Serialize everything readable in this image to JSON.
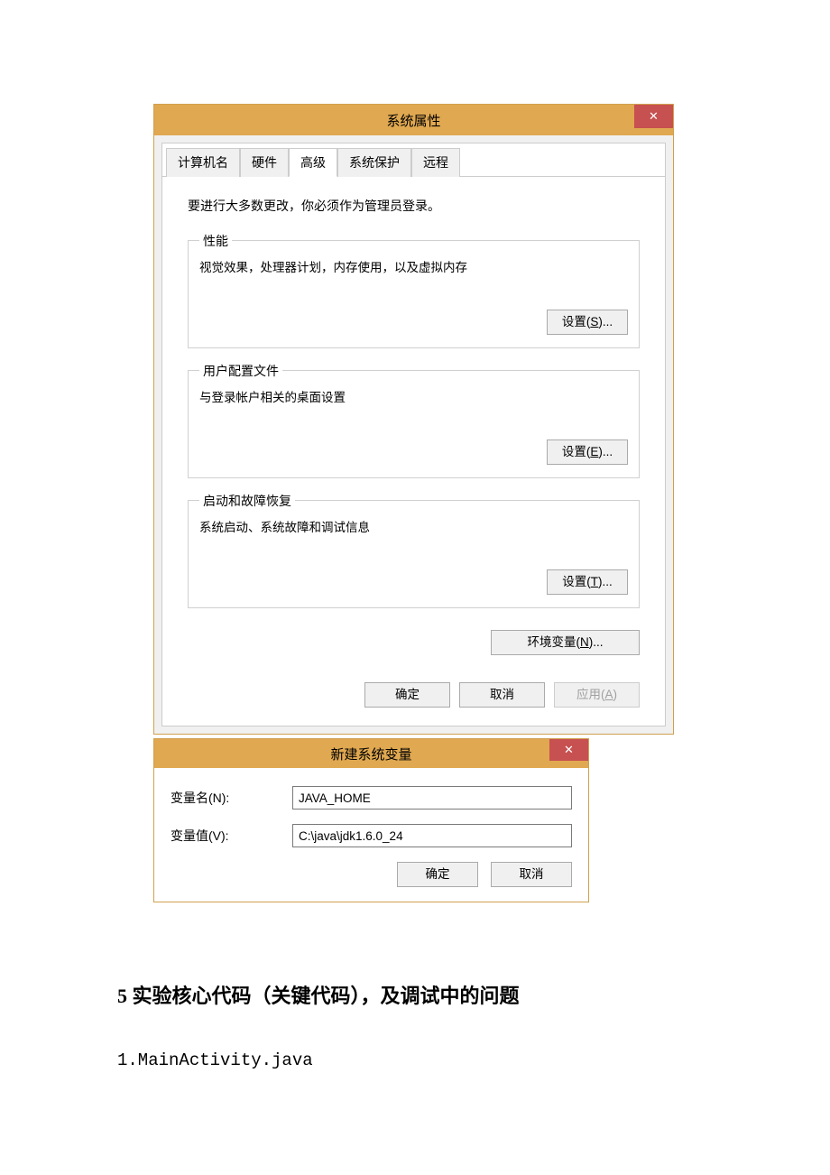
{
  "dialog1": {
    "title": "系统属性",
    "close": "✕",
    "tabs": [
      {
        "label": "计算机名",
        "active": false
      },
      {
        "label": "硬件",
        "active": false
      },
      {
        "label": "高级",
        "active": true
      },
      {
        "label": "系统保护",
        "active": false
      },
      {
        "label": "远程",
        "active": false
      }
    ],
    "admin_note": "要进行大多数更改，你必须作为管理员登录。",
    "perf": {
      "legend": "性能",
      "desc": "视觉效果，处理器计划，内存使用，以及虚拟内存",
      "btn_pre": "设置(",
      "btn_key": "S",
      "btn_post": ")..."
    },
    "profile": {
      "legend": "用户配置文件",
      "desc": "与登录帐户相关的桌面设置",
      "btn_pre": "设置(",
      "btn_key": "E",
      "btn_post": ")..."
    },
    "startup": {
      "legend": "启动和故障恢复",
      "desc": "系统启动、系统故障和调试信息",
      "btn_pre": "设置(",
      "btn_key": "T",
      "btn_post": ")..."
    },
    "env_pre": "环境变量(",
    "env_key": "N",
    "env_post": ")...",
    "ok": "确定",
    "cancel": "取消",
    "apply_pre": "应用(",
    "apply_key": "A",
    "apply_post": ")"
  },
  "dialog2": {
    "title": "新建系统变量",
    "close": "✕",
    "name_label": "变量名(N):",
    "name_value": "JAVA_HOME",
    "value_label": "变量值(V):",
    "value_value": "C:\\java\\jdk1.6.0_24",
    "ok": "确定",
    "cancel": "取消"
  },
  "doc": {
    "heading": "5 实验核心代码（关键代码），及调试中的问题",
    "line1": "1.MainActivity.java"
  }
}
